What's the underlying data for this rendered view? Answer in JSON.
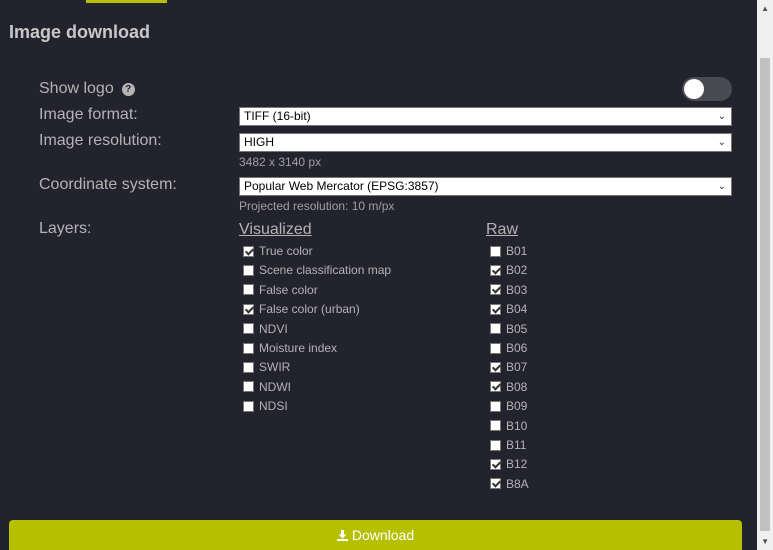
{
  "panel": {
    "title": "Image download"
  },
  "show_logo": {
    "label": "Show logo",
    "help_icon": "?",
    "enabled": false
  },
  "image_format": {
    "label": "Image format:",
    "value": "TIFF (16-bit)"
  },
  "image_resolution": {
    "label": "Image resolution:",
    "value": "HIGH",
    "hint": "3482 x 3140 px"
  },
  "coordinate_system": {
    "label": "Coordinate system:",
    "value": "Popular Web Mercator (EPSG:3857)",
    "hint": "Projected resolution: 10 m/px"
  },
  "layers": {
    "label": "Layers:",
    "visualized": {
      "heading": "Visualized",
      "items": [
        {
          "label": "True color",
          "checked": true
        },
        {
          "label": "Scene classification map",
          "checked": false
        },
        {
          "label": "False color",
          "checked": false
        },
        {
          "label": "False color (urban)",
          "checked": true
        },
        {
          "label": "NDVI",
          "checked": false
        },
        {
          "label": "Moisture index",
          "checked": false
        },
        {
          "label": "SWIR",
          "checked": false
        },
        {
          "label": "NDWI",
          "checked": false
        },
        {
          "label": "NDSI",
          "checked": false
        }
      ]
    },
    "raw": {
      "heading": "Raw",
      "items": [
        {
          "label": "B01",
          "checked": false
        },
        {
          "label": "B02",
          "checked": true
        },
        {
          "label": "B03",
          "checked": true
        },
        {
          "label": "B04",
          "checked": true
        },
        {
          "label": "B05",
          "checked": false
        },
        {
          "label": "B06",
          "checked": false
        },
        {
          "label": "B07",
          "checked": true
        },
        {
          "label": "B08",
          "checked": true
        },
        {
          "label": "B09",
          "checked": false
        },
        {
          "label": "B10",
          "checked": false
        },
        {
          "label": "B11",
          "checked": false
        },
        {
          "label": "B12",
          "checked": true
        },
        {
          "label": "B8A",
          "checked": true
        }
      ]
    }
  },
  "download": {
    "label": "Download",
    "icon": "download-icon"
  },
  "colors": {
    "accent": "#b6bf00",
    "background": "#23232d"
  }
}
